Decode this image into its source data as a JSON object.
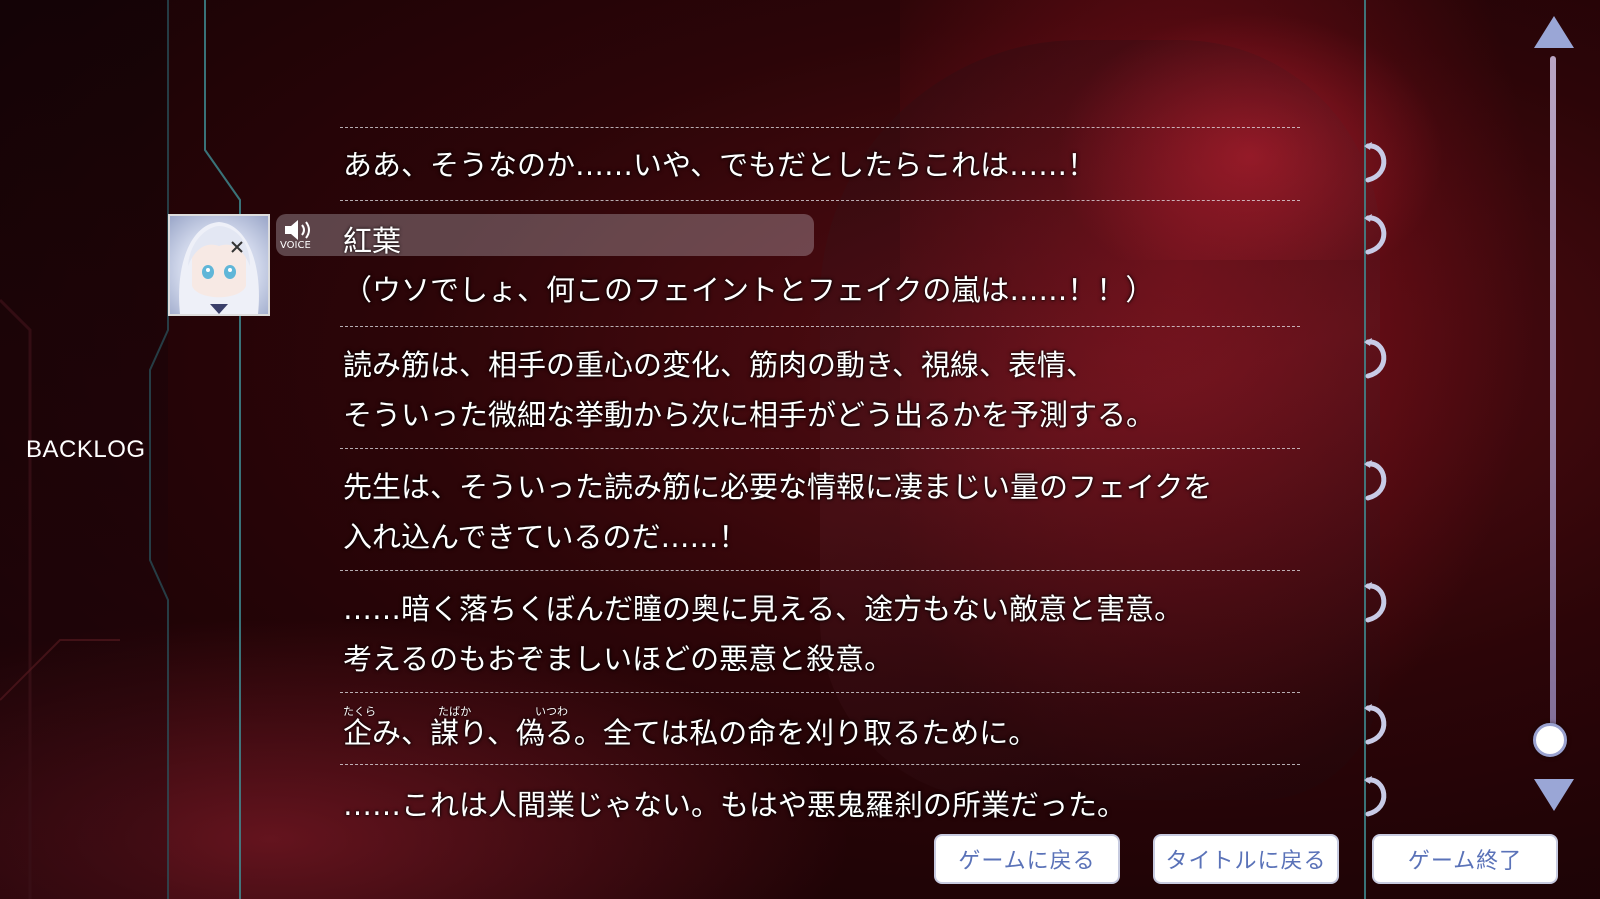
{
  "screen": {
    "title": "BACKLOG"
  },
  "speaker": {
    "name": "紅葉",
    "voice_label": "VOICE"
  },
  "entries": [
    {
      "lines": [
        "ああ、そうなのか……いや、でもだとしたらこれは……！"
      ]
    },
    {
      "lines": [
        "（ウソでしょ、何このフェイントとフェイクの嵐は……！！）"
      ]
    },
    {
      "lines": [
        "読み筋は、相手の重心の変化、筋肉の動き、視線、表情、",
        "そういった微細な挙動から次に相手がどう出るかを予測する。"
      ]
    },
    {
      "lines": [
        "先生は、そういった読み筋に必要な情報に凄まじい量のフェイクを",
        "入れ込んできているのだ……！"
      ]
    },
    {
      "lines": [
        "……暗く落ちくぼんだ瞳の奥に見える、途方もない敵意と害意。",
        "考えるのもおぞましいほどの悪意と殺意。"
      ]
    },
    {
      "lines": [
        "企み、謀り、偽る。全ては私の命を刈り取るために。"
      ],
      "ruby": [
        "たくら",
        "たばか",
        "いつわ"
      ]
    },
    {
      "lines": [
        "……これは人間業じゃない。もはや悪鬼羅刹の所業だった。"
      ]
    }
  ],
  "buttons": {
    "return_game": "ゲームに戻る",
    "return_title": "タイトルに戻る",
    "quit_game": "ゲーム終了"
  },
  "icons": {
    "replay": "replay-arrow-icon",
    "voice": "speaker-icon",
    "scroll_up": "triangle-up-icon",
    "scroll_down": "triangle-down-icon"
  },
  "colors": {
    "accent": "#5a72b8",
    "background": "#2c0508",
    "scroll_track": "#b9a6cc"
  },
  "scroll": {
    "position_fraction": 1.0
  }
}
